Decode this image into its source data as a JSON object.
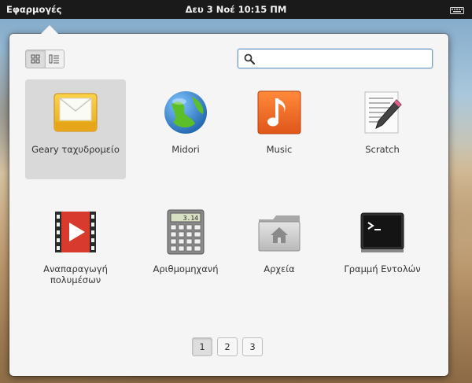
{
  "topbar": {
    "applications_label": "Εφαρμογές",
    "clock": "Δευ  3 Νοέ 10:15 ΠΜ",
    "indicator_icon": "keyboard-icon"
  },
  "launcher": {
    "view_modes": [
      {
        "name": "grid-view-icon",
        "active": true
      },
      {
        "name": "category-view-icon",
        "active": false
      }
    ],
    "search": {
      "value": "",
      "placeholder": ""
    },
    "apps": [
      {
        "label": "Geary ταχυδρομείο",
        "icon": "mail-icon",
        "selected": true
      },
      {
        "label": "Midori",
        "icon": "web-browser-icon",
        "selected": false
      },
      {
        "label": "Music",
        "icon": "music-note-icon",
        "selected": false
      },
      {
        "label": "Scratch",
        "icon": "text-editor-icon",
        "selected": false
      },
      {
        "label": "Αναπαραγωγή πολυμέσων",
        "icon": "video-player-icon",
        "selected": false
      },
      {
        "label": "Αριθμομηχανή",
        "icon": "calculator-icon",
        "selected": false
      },
      {
        "label": "Αρχεία",
        "icon": "home-folder-icon",
        "selected": false
      },
      {
        "label": "Γραμμή Εντολών",
        "icon": "terminal-icon",
        "selected": false
      }
    ],
    "pages": [
      "1",
      "2",
      "3"
    ],
    "current_page": "1",
    "calculator_display": "3.14"
  }
}
